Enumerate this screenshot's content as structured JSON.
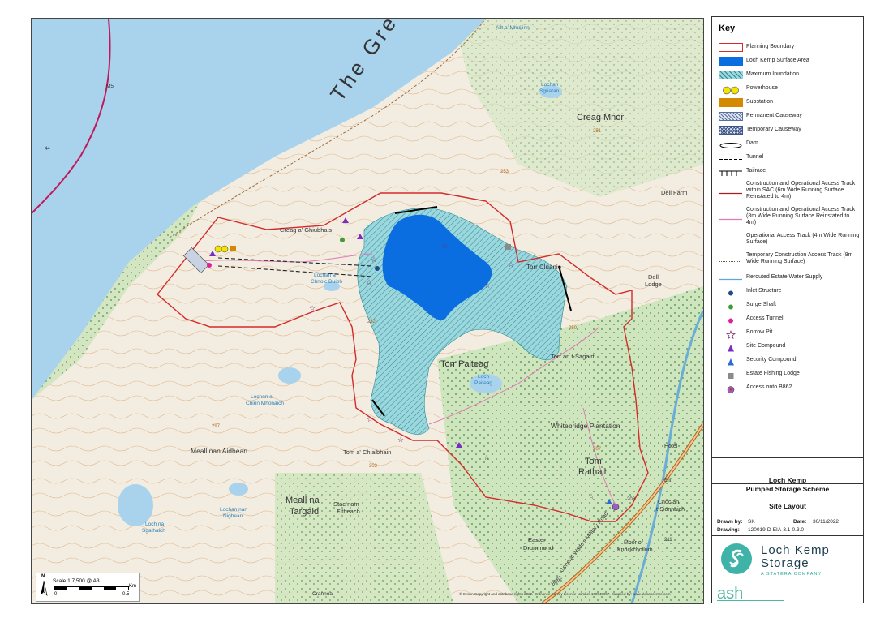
{
  "map": {
    "labels": {
      "great_glen": "The Great Glen",
      "creag_mhor": "Creag Mhòr",
      "torr_paiteag": "Torr Paiteag",
      "torr_cluanie": "Torr Cluanie",
      "torr_an_t_sagairt": "Torr an t-Sagairt",
      "whitebridge": "Whitebridge Plantation",
      "tom_rathail_1": "Tom",
      "tom_rathail_2": "Rathail",
      "meall_nan_aidhean": "Meall nan Aidhean",
      "meall_na_targaid_1": "Meall na",
      "meall_na_targaid_2": "Targaid",
      "tom_a_chlaibhain": "Tom a' Chlaibhain",
      "stac_nam_fitheach_1": "Stac nam",
      "stac_nam_fitheach_2": "Fitheach",
      "easter_1": "Easter",
      "easter_2": "Drummond",
      "dell_lodge_1": "Dell",
      "dell_lodge_2": "Lodge",
      "dell_farm": "Dell Farm",
      "creag_a_ghiubhais": "Creag a' Ghiubhais",
      "loch_paiteag_1": "Loch",
      "loch_paiteag_2": "Paiteag",
      "lochan_a_chnoc_1": "Lochan a'",
      "lochan_a_chnoc_2": "Chnoic Duibh",
      "lochan_chinn_1": "Lochan a'",
      "lochan_chinn_2": "Chinn Mhonaich",
      "lochan_nighean_1": "Lochan nan",
      "lochan_nighean_2": "Nighean",
      "loch_sgathaich_1": "Loch na",
      "loch_sgathaich_2": "Sgathaich",
      "lochan_sgriatan_1": "Lochan",
      "lochan_sgriatan_2": "Sgriatan",
      "allt_mhuilinn": "Allt a' Mhuilinn",
      "hotel": "Hotel",
      "cnoc_1": "Cnoc an",
      "cnoc_2": "t-Sionnaich",
      "moor_1": "Moor of",
      "moor_2": "Knockchoilum",
      "road": "General Wade's Military Road",
      "m5": "M5",
      "ellt": "Ellt",
      "h_251": "251",
      "h_253": "253",
      "h_250": "250",
      "h_232": "232",
      "h_297": "297",
      "h_303": "303",
      "h_307": "307",
      "h_208": "208",
      "h_211": "211",
      "h_44": "44",
      "b862": "B862",
      "crannoa": "Crannoa"
    }
  },
  "key": {
    "title": "Key",
    "items": [
      {
        "label": "Planning Boundary"
      },
      {
        "label": "Loch Kemp Surface Area"
      },
      {
        "label": "Maximum Inundation"
      },
      {
        "label": "Powerhouse"
      },
      {
        "label": "Substation"
      },
      {
        "label": "Permanent Causeway"
      },
      {
        "label": "Temporary Causeway"
      },
      {
        "label": "Dam"
      },
      {
        "label": "Tunnel"
      },
      {
        "label": "Tailrace"
      },
      {
        "label": "Construction and Operational Access Track within SAC (6m Wide Running Surface Reinstated to 4m)"
      },
      {
        "label": "Construction and Operational Access Track (8m Wide Running Surface Reinstated to 4m)"
      },
      {
        "label": "Operational Access Track (4m Wide Running Surface)"
      },
      {
        "label": "Temporary Construction Access Track (8m Wide Running Surface)"
      },
      {
        "label": "Rerouted Estate Water Supply"
      },
      {
        "label": "Inlet Structure"
      },
      {
        "label": "Surge Shaft"
      },
      {
        "label": "Access Tunnel"
      },
      {
        "label": "Borrow Pit"
      },
      {
        "label": "Site Compound"
      },
      {
        "label": "Security Compound"
      },
      {
        "label": "Estate Fishing Lodge"
      },
      {
        "label": "Access onto B862"
      }
    ]
  },
  "title_block": {
    "project_line1": "Loch Kemp",
    "project_line2": "Pumped Storage Scheme",
    "drawing_title": "Site Layout",
    "drawn_by_label": "Drawn by:",
    "drawn_by": "SK",
    "date_label": "Date:",
    "date": "30/11/2022",
    "drawing_label": "Drawing:",
    "drawing_no": "120019-D-EIA-3.1-0.3.0"
  },
  "logos": {
    "brand_line1": "Loch Kemp",
    "brand_line2": "Storage",
    "brand_sub": "A STATERA COMPANY",
    "consultant": "ash"
  },
  "scale": {
    "text": "Scale 1:7,500  @ A3",
    "unit": "Km",
    "tick0": "0",
    "tick1": "0.5",
    "north": "N"
  },
  "copyright": "© Crown Copyright and database rights 2022. Ordnance Survey Licence Number 100048957. Supplied by: www.ukmapcentre.com",
  "colors": {
    "planning_boundary": "#d42a2a",
    "loch_surface": "#0a6de0",
    "inundation": "#7ccdd6",
    "powerhouse": "#f5e400",
    "substation": "#d48a00",
    "water": "#a9d3ec",
    "woodland": "#c9e0b6"
  }
}
